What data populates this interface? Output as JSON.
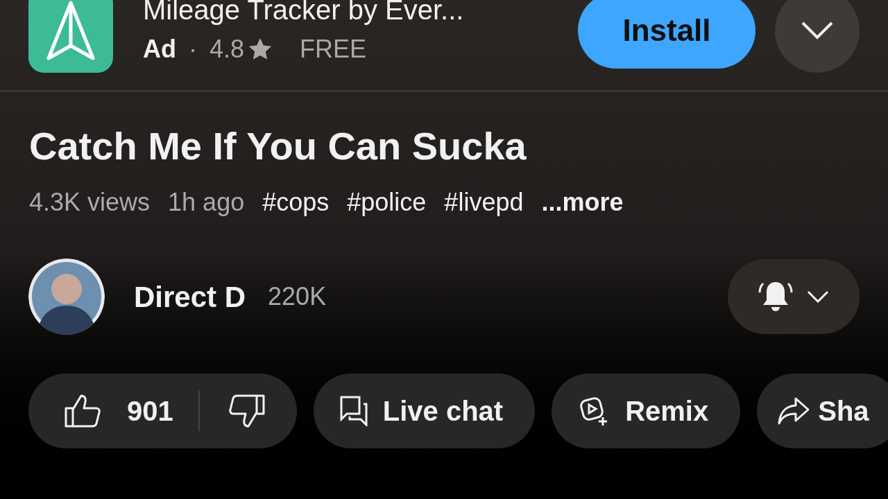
{
  "ad": {
    "app_name": "Mileage Tracker by Ever...",
    "label": "Ad",
    "separator": "·",
    "rating": "4.8",
    "price": "FREE",
    "install": "Install"
  },
  "video": {
    "title": "Catch Me If You Can Sucka",
    "views": "4.3K views",
    "age": "1h ago",
    "hashtags": [
      "#cops",
      "#police",
      "#livepd"
    ],
    "more": "...more"
  },
  "channel": {
    "name": "Direct D",
    "subscribers": "220K"
  },
  "actions": [
    {
      "kind": "like",
      "count": "901"
    },
    {
      "kind": "chat",
      "label": "Live chat"
    },
    {
      "kind": "remix",
      "label": "Remix"
    },
    {
      "kind": "share",
      "label": "Sha"
    }
  ]
}
